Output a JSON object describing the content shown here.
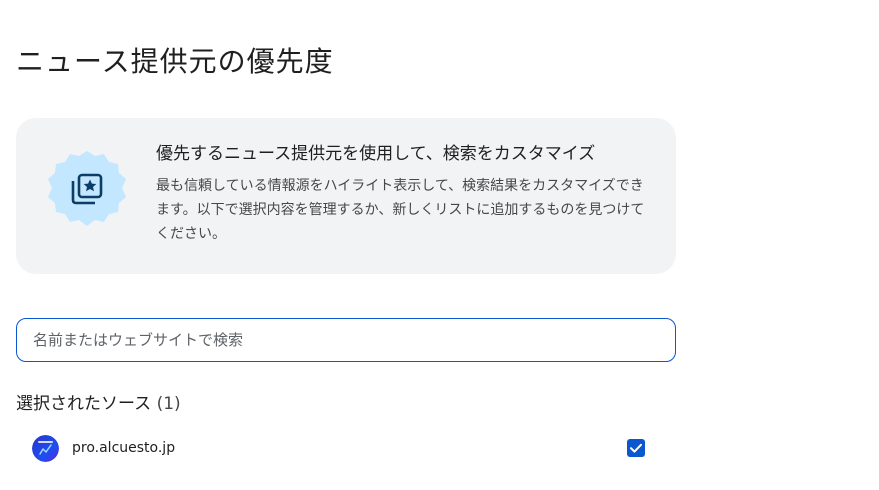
{
  "page": {
    "title": "ニュース提供元の優先度"
  },
  "info_card": {
    "icon": "star-gallery-icon",
    "heading": "優先するニュース提供元を使用して、検索をカスタマイズ",
    "description": "最も信頼している情報源をハイライト表示して、検索結果をカスタマイズできます。以下で選択内容を管理するか、新しくリストに追加するものを見つけてください。"
  },
  "search": {
    "placeholder": "名前またはウェブサイトで検索",
    "value": ""
  },
  "selected_sources": {
    "title": "選択されたソース",
    "count": "(1)",
    "items": [
      {
        "name": "pro.alcuesto.jp",
        "checked": true,
        "logo_icon": "alcuesto-logo-icon"
      }
    ]
  },
  "colors": {
    "accent": "#0b57d0",
    "card_bg": "#f2f3f5",
    "badge_bg": "#c2e7ff",
    "badge_icon": "#0b3d66"
  }
}
